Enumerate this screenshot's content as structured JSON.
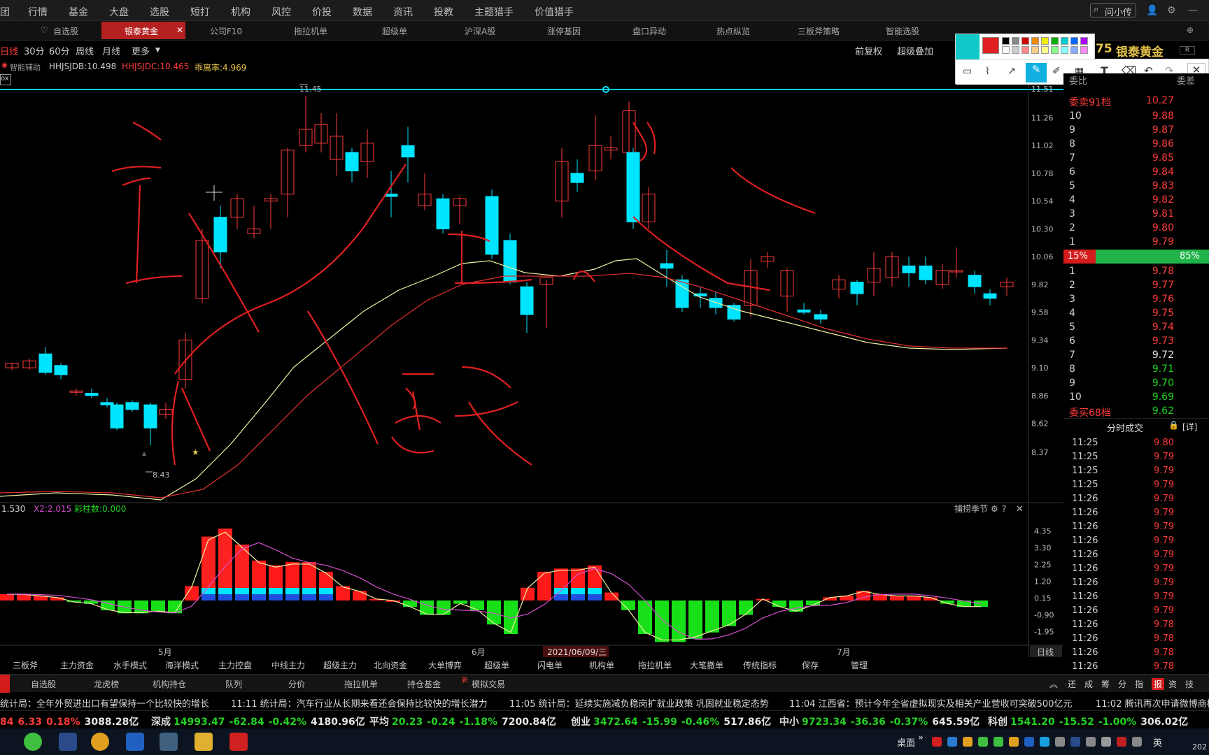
{
  "menu": {
    "items": [
      "行情",
      "基金",
      "大盘",
      "选股",
      "短打",
      "机构",
      "风控",
      "价投",
      "数据",
      "资讯",
      "投教",
      "主题猎手",
      "价值猎手"
    ],
    "search_label": "问小传"
  },
  "tabs": {
    "items": [
      "自选股",
      "银泰黄金",
      "公司F10",
      "拖拉机单",
      "超级单",
      "沪深A股",
      "涨停基因",
      "盘口异动",
      "热点纵览",
      "三板斧策略",
      "智能选股"
    ],
    "active": "银泰黄金"
  },
  "periods": {
    "items": [
      "日线",
      "30分",
      "60分",
      "周线",
      "月线",
      "更多"
    ],
    "right": [
      "前复权",
      "超级叠加"
    ]
  },
  "indicators": {
    "label0": "智能辅助",
    "hh1": "HHJSJDB:10.498",
    "hh2": "HHJSJDC:10.465",
    "hh3": "乖离率:4.969"
  },
  "stock": {
    "price": "75",
    "name": "银泰黄金"
  },
  "price_axis": [
    "11.51",
    "11.26",
    "11.02",
    "10.78",
    "10.54",
    "10.30",
    "10.06",
    "9.82",
    "9.58",
    "9.34",
    "9.10",
    "8.86",
    "8.62",
    "8.37"
  ],
  "chart_labels": {
    "high": "11.45",
    "low": "8.43"
  },
  "macd_labels": {
    "m1": "1.530",
    "m2": "X2:2.015",
    "m3": "彩柱数:0.000",
    "panel_title": "捕捞季节"
  },
  "macd_axis": [
    "4.35",
    "3.30",
    "2.25",
    "1.20",
    "0.15",
    "-0.90",
    "-1.95"
  ],
  "time_axis": {
    "may": "5月",
    "jun": "6月",
    "date": "2021/06/09/三",
    "jul": "7月",
    "period": "日线"
  },
  "orderbook": {
    "header": {
      "left": "委比",
      "right": "委差"
    },
    "sell_title": "委卖91档",
    "sell_title_price": "10.27",
    "sells": [
      [
        "10",
        "9.88"
      ],
      [
        "9",
        "9.87"
      ],
      [
        "8",
        "9.86"
      ],
      [
        "7",
        "9.85"
      ],
      [
        "6",
        "9.84"
      ],
      [
        "5",
        "9.83"
      ],
      [
        "4",
        "9.82"
      ],
      [
        "3",
        "9.81"
      ],
      [
        "2",
        "9.80"
      ],
      [
        "1",
        "9.79"
      ]
    ],
    "ratio_sell": "15%",
    "ratio_buy": "85%",
    "buys": [
      [
        "1",
        "9.78"
      ],
      [
        "2",
        "9.77"
      ],
      [
        "3",
        "9.76"
      ],
      [
        "4",
        "9.75"
      ],
      [
        "5",
        "9.74"
      ],
      [
        "6",
        "9.73"
      ],
      [
        "7",
        "9.72"
      ],
      [
        "8",
        "9.71"
      ],
      [
        "9",
        "9.70"
      ],
      [
        "10",
        "9.69"
      ]
    ],
    "buy_title": "委买68档",
    "buy_title_price": "9.62"
  },
  "trades": {
    "title": "分时成交",
    "detail": "[详]",
    "rows": [
      [
        "11:25",
        "9.80"
      ],
      [
        "11:25",
        "9.79"
      ],
      [
        "11:25",
        "9.79"
      ],
      [
        "11:25",
        "9.79"
      ],
      [
        "11:26",
        "9.79"
      ],
      [
        "11:26",
        "9.79"
      ],
      [
        "11:26",
        "9.79"
      ],
      [
        "11:26",
        "9.79"
      ],
      [
        "11:26",
        "9.79"
      ],
      [
        "11:26",
        "9.79"
      ],
      [
        "11:26",
        "9.79"
      ],
      [
        "11:26",
        "9.79"
      ],
      [
        "11:26",
        "9.79"
      ],
      [
        "11:26",
        "9.78"
      ],
      [
        "11:26",
        "9.78"
      ],
      [
        "11:26",
        "9.78"
      ],
      [
        "11:26",
        "9.78"
      ]
    ]
  },
  "bottom_nav": [
    "三板斧",
    "主力资金",
    "水手模式",
    "海洋模式",
    "主力控盘",
    "中线主力",
    "超级主力",
    "北向资金",
    "大单博弈",
    "超级单",
    "闪电单",
    "机构单",
    "拖拉机单",
    "大笔撤单",
    "传统指标",
    "保存",
    "管理"
  ],
  "tabs2": {
    "items": [
      "自选股",
      "龙虎榜",
      "机构持仓",
      "队列",
      "分价",
      "拖拉机单",
      "持仓基金",
      "模拟交易"
    ],
    "right": [
      "还",
      "成",
      "筹",
      "分",
      "指",
      "报",
      "资",
      "技"
    ]
  },
  "news": [
    "统计局：全年外贸进出口有望保持一个比较快的增长",
    "11:11 统计局：汽车行业从长期来看还会保持比较快的增长潜力",
    "11:05 统计局：延续实施减负稳岗扩就业政策 巩固就业稳定态势",
    "11:04 江西省：预计今年全省虚拟现实及相关产业营收可突破500亿元",
    "11:02 腾讯再次申请微博商标"
  ],
  "indices": [
    {
      "name": "",
      "v1": "84",
      "v2": "6.33",
      "v3": "0.18%",
      "v4": "3088.28亿"
    },
    {
      "name": "深成",
      "v1": "14993.47",
      "v2": "-62.84",
      "v3": "-0.42%",
      "v4": "4180.96亿"
    },
    {
      "name": "平均",
      "v1": "20.23",
      "v2": "-0.24",
      "v3": "-1.18%",
      "v4": "7200.84亿"
    },
    {
      "name": "创业",
      "v1": "3472.64",
      "v2": "-15.99",
      "v3": "-0.46%",
      "v4": "517.86亿"
    },
    {
      "name": "中小",
      "v1": "9723.34",
      "v2": "-36.36",
      "v3": "-0.37%",
      "v4": "645.59亿"
    },
    {
      "name": "科创",
      "v1": "1541.20",
      "v2": "-15.52",
      "v3": "-1.00%",
      "v4": "306.02亿"
    }
  ],
  "taskbar": {
    "desktop": "桌面",
    "lang": "英",
    "year": "202"
  },
  "colors": {
    "up": "#ff3b3b",
    "down": "#00e5ff",
    "ma5": "#f0f0a0",
    "ma10": "#e03030",
    "annot": "#e02020",
    "macd_green": "#18e018"
  }
}
